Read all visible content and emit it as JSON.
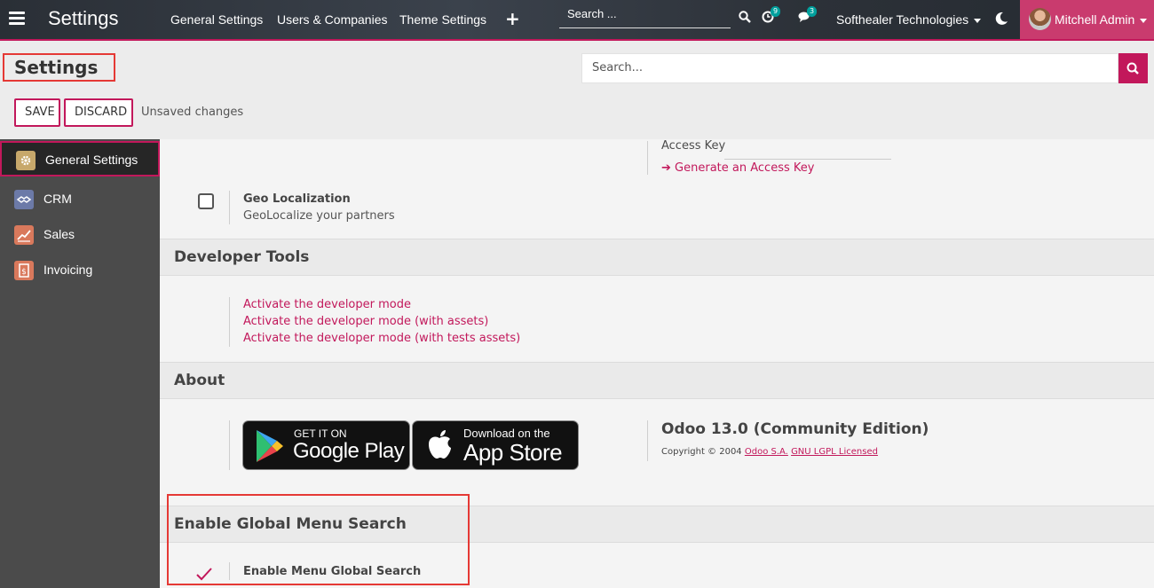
{
  "navbar": {
    "app_title": "Settings",
    "menus": [
      "General Settings",
      "Users & Companies",
      "Theme Settings"
    ],
    "search_placeholder": "Search ...",
    "activity_count": "9",
    "message_count": "3",
    "company": "Softhealer Technologies",
    "user": "Mitchell Admin"
  },
  "control": {
    "title": "Settings",
    "search_placeholder": "Search...",
    "save_label": "SAVE",
    "discard_label": "DISCARD",
    "status": "Unsaved changes"
  },
  "sidebar": {
    "items": [
      {
        "label": "General Settings",
        "icon": "gear-icon",
        "color": "#c7a86b"
      },
      {
        "label": "CRM",
        "icon": "handshake-icon",
        "color": "#6c7aa8"
      },
      {
        "label": "Sales",
        "icon": "chart-line-icon",
        "color": "#d9795c"
      },
      {
        "label": "Invoicing",
        "icon": "invoice-icon",
        "color": "#d9795c"
      }
    ]
  },
  "main": {
    "access_key": {
      "label": "Access Key",
      "link": "Generate an Access Key"
    },
    "geo": {
      "title": "Geo Localization",
      "desc": "GeoLocalize your partners"
    },
    "developer": {
      "heading": "Developer Tools",
      "links": [
        "Activate the developer mode",
        "Activate the developer mode (with assets)",
        "Activate the developer mode (with tests assets)"
      ]
    },
    "about": {
      "heading": "About",
      "google_small": "GET IT ON",
      "google_big": "Google Play",
      "apple_small": "Download on the",
      "apple_big": "App Store",
      "version": "Odoo 13.0 (Community Edition)",
      "copyright": "Copyright © 2004",
      "company_link": "Odoo S.A.",
      "license_link": "GNU LGPL Licensed"
    },
    "global_search": {
      "heading": "Enable Global Menu Search",
      "option": "Enable Menu Global Search"
    }
  },
  "colors": {
    "accent": "#c2185b",
    "highlight": "#e53935"
  }
}
